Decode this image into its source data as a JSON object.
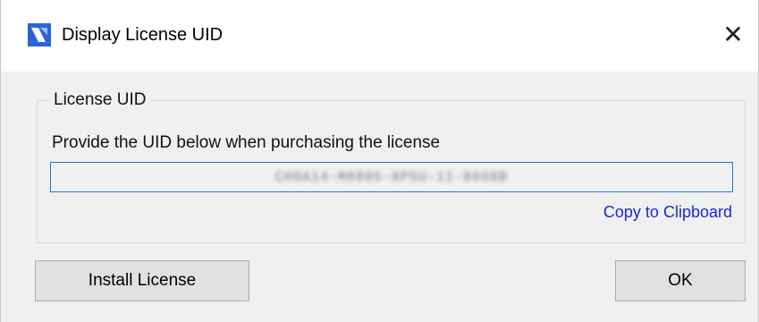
{
  "window": {
    "title": "Display License UID",
    "close_glyph": "✕",
    "icon": "bricscad-logo-icon"
  },
  "group": {
    "legend": "License UID",
    "instruction": "Provide the UID below when purchasing the license",
    "uid_value": "CH0A14-M8805-8P5U-11-86G8B",
    "copy_link": "Copy to Clipboard"
  },
  "buttons": {
    "install": "Install License",
    "ok": "OK"
  },
  "colors": {
    "link": "#1a27d6",
    "field_border": "#1979ca",
    "logo_blue": "#2a64d6"
  }
}
